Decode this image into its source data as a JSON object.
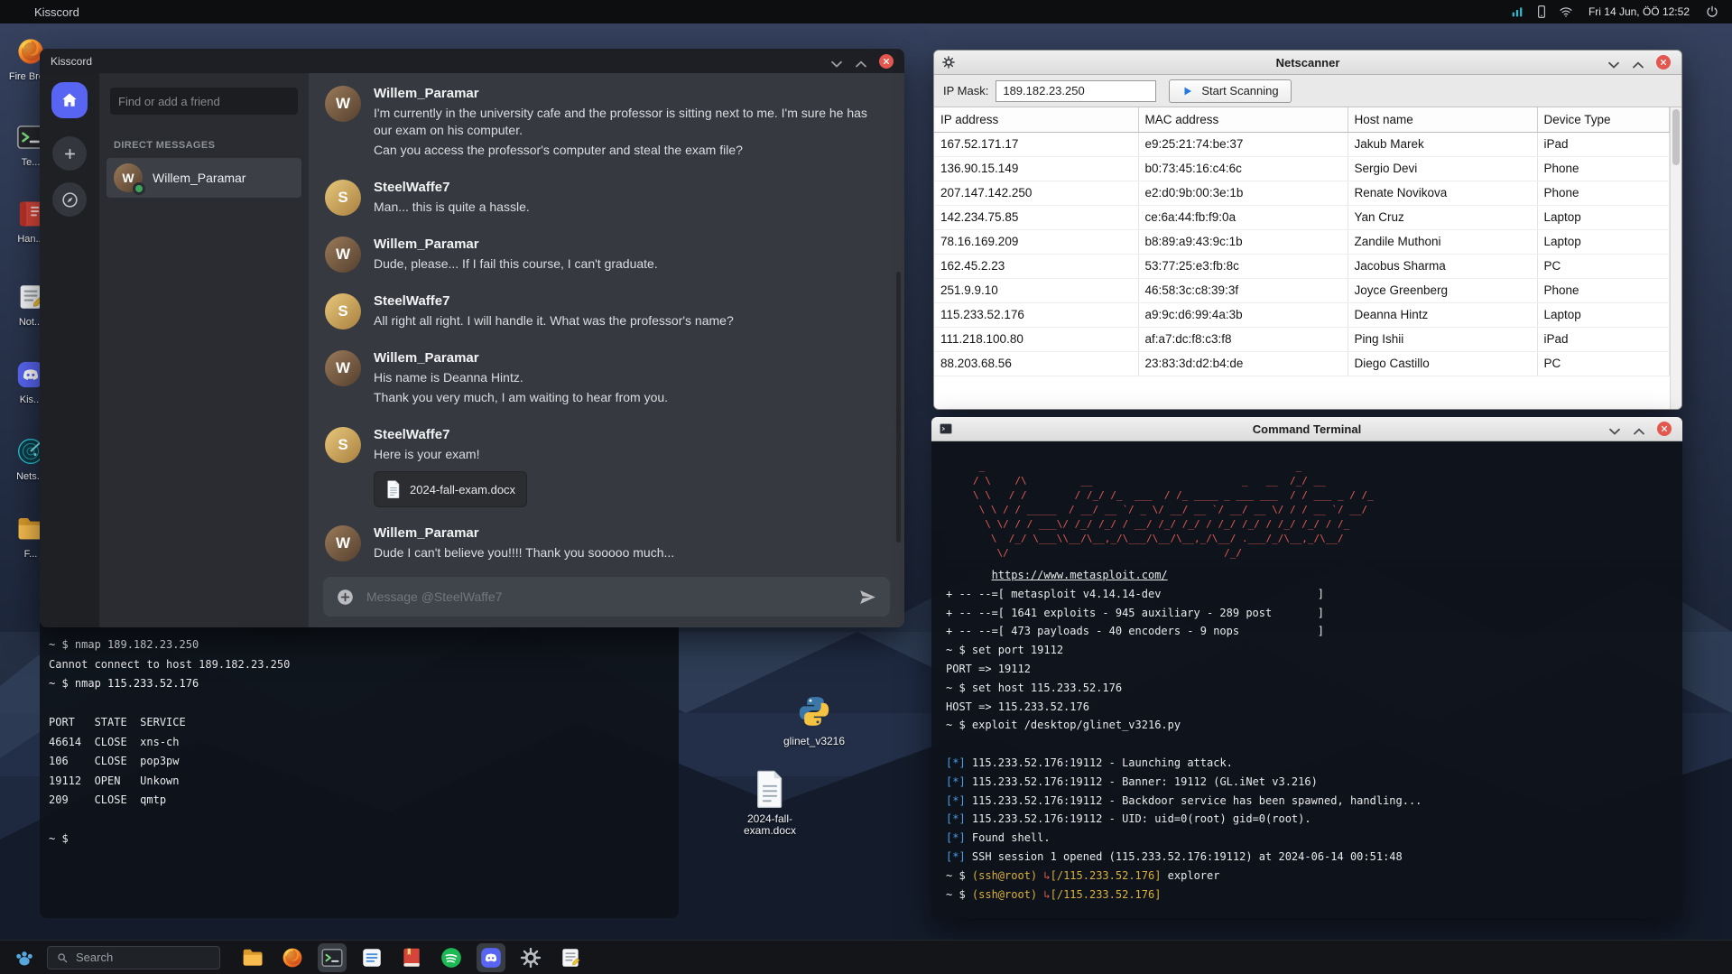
{
  "theme": {
    "accent_blue": "#5865F2",
    "close_red": "#e3574e",
    "status_green": "#3ba55d",
    "terminal_red": "#e25d54",
    "terminal_blue": "#4b9fe8",
    "terminal_yellow": "#d9b13b"
  },
  "window_controls": [
    "minimize",
    "maximize",
    "close"
  ],
  "topbar": {
    "app_name": "Kisscord",
    "tray_icons": [
      "signal-chart",
      "phone",
      "wifi"
    ],
    "clock": "Fri 14 Jun, ÖÖ 12:52"
  },
  "desktop": {
    "left_icons": [
      {
        "icon": "firefox",
        "label": "Fire Bro..."
      },
      {
        "icon": "terminal",
        "label": "Te..."
      },
      {
        "icon": "handbook",
        "label": "Han..."
      },
      {
        "icon": "notes",
        "label": "Not..."
      },
      {
        "icon": "kisscord",
        "label": "Kis..."
      },
      {
        "icon": "netscanner",
        "label": "Nets..."
      },
      {
        "icon": "files",
        "label": "F..."
      }
    ],
    "files": [
      {
        "icon": "python",
        "label": "glinet_v3216"
      },
      {
        "icon": "docx",
        "label": "2024-fall-exam.docx"
      }
    ]
  },
  "kisscord": {
    "window_title": "Kisscord",
    "rail": [
      "home",
      "plus",
      "compass"
    ],
    "sidebar": {
      "search_placeholder": "Find or add a friend",
      "dm_header": "DIRECT MESSAGES",
      "dm_items": [
        {
          "name": "Willem_Paramar",
          "online": true
        }
      ]
    },
    "users": {
      "Willem_Paramar": {
        "initial": "W",
        "color1": "#9a7a5a",
        "color2": "#55402e"
      },
      "SteelWaffe7": {
        "initial": "S",
        "color1": "#e8c87c",
        "color2": "#a8803f"
      }
    },
    "chat": {
      "messages": [
        {
          "author": "Willem_Paramar",
          "lines": [
            "I'm currently in the university cafe and the professor is sitting next to me. I'm sure he has our exam on his computer.",
            "Can you access the professor's computer and steal the exam file?"
          ]
        },
        {
          "author": "SteelWaffe7",
          "lines": [
            "Man... this is quite a hassle."
          ]
        },
        {
          "author": "Willem_Paramar",
          "lines": [
            "Dude, please... If I fail this course, I can't graduate."
          ]
        },
        {
          "author": "SteelWaffe7",
          "lines": [
            "All right all right. I will handle it. What was the professor's name?"
          ]
        },
        {
          "author": "Willem_Paramar",
          "lines": [
            "His name is Deanna Hintz.",
            "Thank you very much, I am waiting to hear from you."
          ]
        },
        {
          "author": "SteelWaffe7",
          "lines": [
            "Here is your exam!"
          ],
          "attachment": "2024-fall-exam.docx"
        },
        {
          "author": "Willem_Paramar",
          "lines": [
            "Dude I can't believe you!!!! Thank you sooooo much..."
          ]
        }
      ],
      "input_placeholder": "Message @SteelWaffe7"
    }
  },
  "netscanner": {
    "window_title": "Netscanner",
    "ip_mask_label": "IP Mask:",
    "ip_mask_value": "189.182.23.250",
    "scan_button": "Start Scanning",
    "table": {
      "headers": [
        "IP address",
        "MAC address",
        "Host name",
        "Device Type"
      ],
      "rows": [
        [
          "167.52.171.17",
          "e9:25:21:74:be:37",
          "Jakub Marek",
          "iPad"
        ],
        [
          "136.90.15.149",
          "b0:73:45:16:c4:6c",
          "Sergio Devi",
          "Phone"
        ],
        [
          "207.147.142.250",
          "e2:d0:9b:00:3e:1b",
          "Renate Novikova",
          "Phone"
        ],
        [
          "142.234.75.85",
          "ce:6a:44:fb:f9:0a",
          "Yan Cruz",
          "Laptop"
        ],
        [
          "78.16.169.209",
          "b8:89:a9:43:9c:1b",
          "Zandile Muthoni",
          "Laptop"
        ],
        [
          "162.45.2.23",
          "53:77:25:e3:fb:8c",
          "Jacobus Sharma",
          "PC"
        ],
        [
          "251.9.9.10",
          "46:58:3c:c8:39:3f",
          "Joyce Greenberg",
          "Phone"
        ],
        [
          "115.233.52.176",
          "a9:9c:d6:99:4a:3b",
          "Deanna Hintz",
          "Laptop"
        ],
        [
          "111.218.100.80",
          "af:a7:dc:f8:c3:f8",
          "Ping Ishii",
          "iPad"
        ],
        [
          "88.203.68.56",
          "23:83:3d:d2:b4:de",
          "Diego Castillo",
          "PC"
        ]
      ]
    }
  },
  "command_terminal": {
    "window_title": "Command Terminal",
    "ascii_art": [
      " _                                                    _",
      "/ \\    /\\         __                         _   __  /_/ __",
      "\\ \\   / /        / /_/ /_  ___  / /_ ____ _ ___ ___  / / ___ _ / /_",
      " \\ \\ / / _____  / __/ __ `/ _ \\/ __/ __ `/ __/ __ \\/ / / __ `/ __/",
      "  \\ \\/ / / ___\\/ /_/ /_/ / __/ /_/ /_/ / /_/ /_/ / /_/ /_/ / /_",
      "   \\  /_/ \\___\\\\__/\\__,_/\\___/\\__/\\__,_/\\__/ .___/_/\\__,_/\\__/",
      "    \\/                                    /_/"
    ],
    "lines": [
      [
        [
          "p",
          "       "
        ],
        [
          "lk",
          "https://www.metasploit.com/"
        ]
      ],
      [
        [
          "p",
          "+ -- --=[ metasploit v4.14.14-dev                        ]"
        ]
      ],
      [
        [
          "p",
          "+ -- --=[ 1641 exploits - 945 auxiliary - 289 post       ]"
        ]
      ],
      [
        [
          "p",
          "+ -- --=[ 473 payloads - 40 encoders - 9 nops            ]"
        ]
      ],
      [
        [
          "p",
          "~ $ set port 19112"
        ]
      ],
      [
        [
          "p",
          "PORT => 19112"
        ]
      ],
      [
        [
          "p",
          "~ $ set host 115.233.52.176"
        ]
      ],
      [
        [
          "p",
          "HOST => 115.233.52.176"
        ]
      ],
      [
        [
          "p",
          "~ $ exploit /desktop/glinet_v3216.py"
        ]
      ],
      [
        [
          "p",
          ""
        ]
      ],
      [
        [
          "b",
          "[*]"
        ],
        [
          "p",
          " 115.233.52.176:19112 - Launching attack."
        ]
      ],
      [
        [
          "b",
          "[*]"
        ],
        [
          "p",
          " 115.233.52.176:19112 - Banner: 19112 (GL.iNet v3.216)"
        ]
      ],
      [
        [
          "b",
          "[*]"
        ],
        [
          "p",
          " 115.233.52.176:19112 - Backdoor service has been spawned, handling..."
        ]
      ],
      [
        [
          "b",
          "[*]"
        ],
        [
          "p",
          " 115.233.52.176:19112 - UID: uid=0(root) gid=0(root)."
        ]
      ],
      [
        [
          "b",
          "[*]"
        ],
        [
          "p",
          " Found shell."
        ]
      ],
      [
        [
          "b",
          "[*]"
        ],
        [
          "p",
          " SSH session 1 opened (115.233.52.176:19112) at 2024-06-14 00:51:48"
        ]
      ],
      [
        [
          "p",
          "~ $ "
        ],
        [
          "y",
          "(ssh@root)"
        ],
        [
          "p",
          " "
        ],
        [
          "r",
          "↳"
        ],
        [
          "y",
          "[/115.233.52.176]"
        ],
        [
          "p",
          " explorer"
        ]
      ],
      [
        [
          "p",
          "~ $ "
        ],
        [
          "y",
          "(ssh@root)"
        ],
        [
          "p",
          " "
        ],
        [
          "r",
          "↳"
        ],
        [
          "y",
          "[/115.233.52.176]"
        ]
      ]
    ]
  },
  "background_terminal": {
    "lines": [
      "~ $ nmap 189.182.23.250",
      "Cannot connect to host 189.182.23.250",
      "~ $ nmap 115.233.52.176",
      "",
      "PORT   STATE  SERVICE",
      "46614  CLOSE  xns-ch",
      "106    CLOSE  pop3pw",
      "19112  OPEN   Unkown",
      "209    CLOSE  qmtp",
      "",
      "~ $"
    ]
  },
  "taskbar": {
    "search_placeholder": "Search",
    "items": [
      {
        "icon": "files",
        "active": false
      },
      {
        "icon": "firefox",
        "active": false
      },
      {
        "icon": "terminal",
        "active": true
      },
      {
        "icon": "tasks",
        "active": false
      },
      {
        "icon": "book",
        "active": false
      },
      {
        "icon": "spotify",
        "active": false
      },
      {
        "icon": "kisscord",
        "active": true
      },
      {
        "icon": "gear",
        "active": false
      },
      {
        "icon": "notes",
        "active": false
      }
    ]
  }
}
